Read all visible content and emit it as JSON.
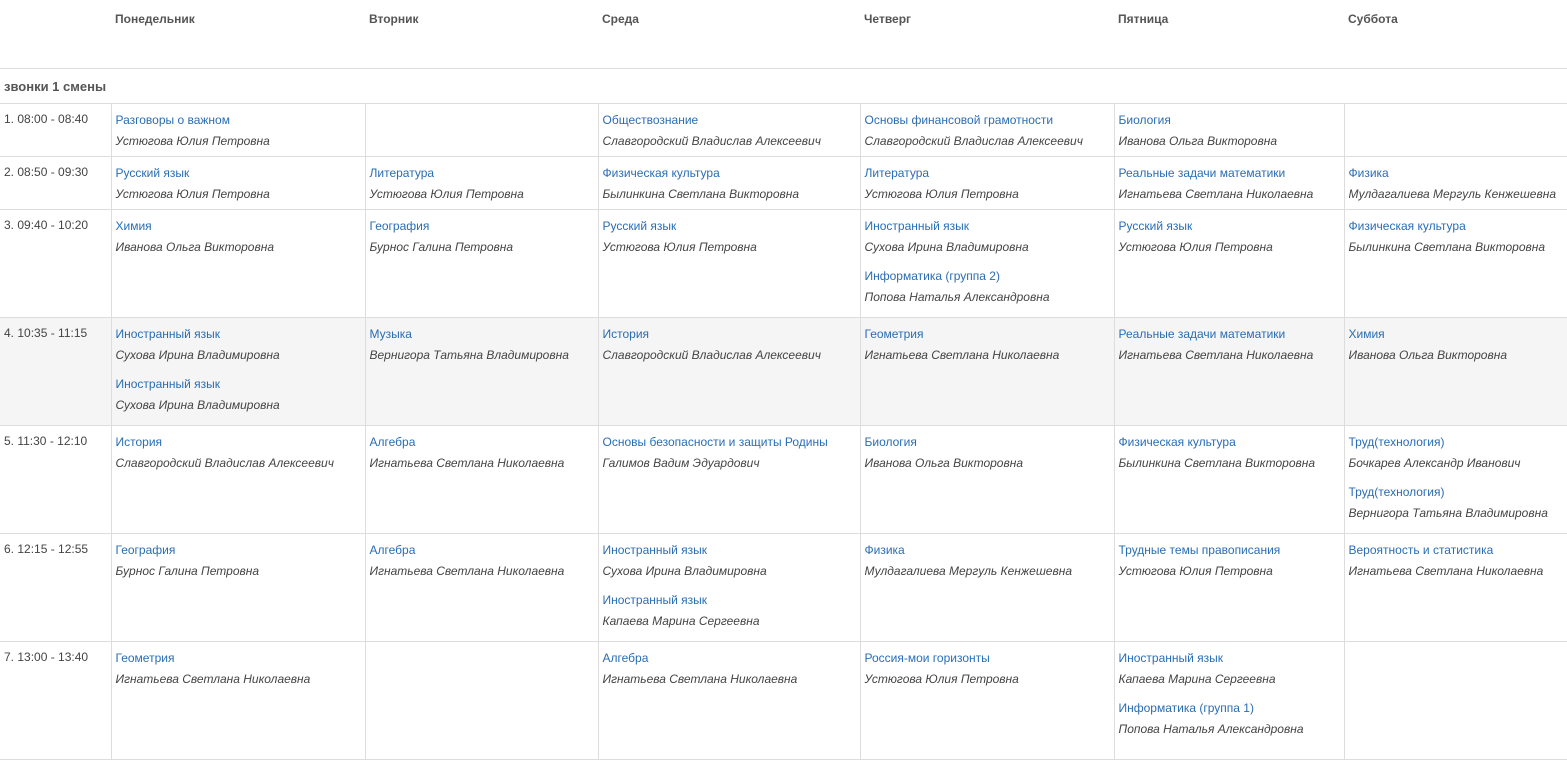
{
  "days": [
    "Понедельник",
    "Вторник",
    "Среда",
    "Четверг",
    "Пятница",
    "Суббота"
  ],
  "shift_title": "звонки 1 смены",
  "rows": [
    {
      "time": "1. 08:00 - 08:40",
      "cells": [
        [
          {
            "subject": "Разговоры о важном",
            "teacher": "Устюгова Юлия Петровна"
          }
        ],
        [],
        [
          {
            "subject": "Обществознание",
            "teacher": "Славгородский Владислав Алексеевич"
          }
        ],
        [
          {
            "subject": "Основы финансовой грамотности",
            "teacher": "Славгородский Владислав Алексеевич"
          }
        ],
        [
          {
            "subject": "Биология",
            "teacher": "Иванова Ольга Викторовна"
          }
        ],
        []
      ]
    },
    {
      "time": "2. 08:50 - 09:30",
      "cells": [
        [
          {
            "subject": "Русский язык",
            "teacher": "Устюгова Юлия Петровна"
          }
        ],
        [
          {
            "subject": "Литература",
            "teacher": "Устюгова Юлия Петровна"
          }
        ],
        [
          {
            "subject": "Физическая культура",
            "teacher": "Былинкина Светлана Викторовна"
          }
        ],
        [
          {
            "subject": "Литература",
            "teacher": "Устюгова Юлия Петровна"
          }
        ],
        [
          {
            "subject": "Реальные задачи математики",
            "teacher": "Игнатьева Светлана Николаевна"
          }
        ],
        [
          {
            "subject": "Физика",
            "teacher": "Мулдагалиева Мергуль Кенжешевна"
          }
        ]
      ]
    },
    {
      "time": "3. 09:40 - 10:20",
      "cells": [
        [
          {
            "subject": "Химия",
            "teacher": "Иванова Ольга Викторовна"
          }
        ],
        [
          {
            "subject": "География",
            "teacher": "Бурнос Галина Петровна"
          }
        ],
        [
          {
            "subject": "Русский язык",
            "teacher": "Устюгова Юлия Петровна"
          }
        ],
        [
          {
            "subject": "Иностранный язык",
            "teacher": "Сухова Ирина Владимировна"
          },
          {
            "subject": "Информатика (группа 2)",
            "teacher": "Попова Наталья Александровна"
          }
        ],
        [
          {
            "subject": "Русский язык",
            "teacher": "Устюгова Юлия Петровна"
          }
        ],
        [
          {
            "subject": "Физическая культура",
            "teacher": "Былинкина Светлана Викторовна"
          }
        ]
      ]
    },
    {
      "time": "4. 10:35 - 11:15",
      "cells": [
        [
          {
            "subject": "Иностранный язык",
            "teacher": "Сухова Ирина Владимировна"
          },
          {
            "subject": "Иностранный язык",
            "teacher": "Сухова Ирина Владимировна"
          }
        ],
        [
          {
            "subject": "Музыка",
            "teacher": "Вернигора Татьяна Владимировна"
          }
        ],
        [
          {
            "subject": "История",
            "teacher": "Славгородский Владислав Алексеевич"
          }
        ],
        [
          {
            "subject": "Геометрия",
            "teacher": "Игнатьева Светлана Николаевна"
          }
        ],
        [
          {
            "subject": "Реальные задачи математики",
            "teacher": "Игнатьева Светлана Николаевна"
          }
        ],
        [
          {
            "subject": "Химия",
            "teacher": "Иванова Ольга Викторовна"
          }
        ]
      ]
    },
    {
      "time": "5. 11:30 - 12:10",
      "cells": [
        [
          {
            "subject": "История",
            "teacher": "Славгородский Владислав Алексеевич"
          }
        ],
        [
          {
            "subject": "Алгебра",
            "teacher": "Игнатьева Светлана Николаевна"
          }
        ],
        [
          {
            "subject": "Основы безопасности и защиты Родины",
            "teacher": "Галимов Вадим Эдуардович"
          }
        ],
        [
          {
            "subject": "Биология",
            "teacher": "Иванова Ольга Викторовна"
          }
        ],
        [
          {
            "subject": "Физическая культура",
            "teacher": "Былинкина Светлана Викторовна"
          }
        ],
        [
          {
            "subject": "Труд(технология)",
            "teacher": "Бочкарев Александр Иванович"
          },
          {
            "subject": "Труд(технология)",
            "teacher": "Вернигора Татьяна Владимировна"
          }
        ]
      ]
    },
    {
      "time": "6. 12:15 - 12:55",
      "cells": [
        [
          {
            "subject": "География",
            "teacher": "Бурнос Галина Петровна"
          }
        ],
        [
          {
            "subject": "Алгебра",
            "teacher": "Игнатьева Светлана Николаевна"
          }
        ],
        [
          {
            "subject": "Иностранный язык",
            "teacher": "Сухова Ирина Владимировна"
          },
          {
            "subject": "Иностранный язык",
            "teacher": "Капаева Марина Сергеевна"
          }
        ],
        [
          {
            "subject": "Физика",
            "teacher": "Мулдагалиева Мергуль Кенжешевна"
          }
        ],
        [
          {
            "subject": "Трудные темы правописания",
            "teacher": "Устюгова Юлия Петровна"
          }
        ],
        [
          {
            "subject": "Вероятность и статистика",
            "teacher": "Игнатьева Светлана Николаевна"
          }
        ]
      ]
    },
    {
      "time": "7. 13:00 - 13:40",
      "cells": [
        [
          {
            "subject": "Геометрия",
            "teacher": "Игнатьева Светлана Николаевна"
          }
        ],
        [],
        [
          {
            "subject": "Алгебра",
            "teacher": "Игнатьева Светлана Николаевна"
          }
        ],
        [
          {
            "subject": "Россия-мои горизонты",
            "teacher": "Устюгова Юлия Петровна"
          }
        ],
        [
          {
            "subject": "Иностранный язык",
            "teacher": "Капаева Марина Сергеевна"
          },
          {
            "subject": "Информатика (группа 1)",
            "teacher": "Попова Наталья Александровна"
          }
        ],
        []
      ]
    }
  ]
}
